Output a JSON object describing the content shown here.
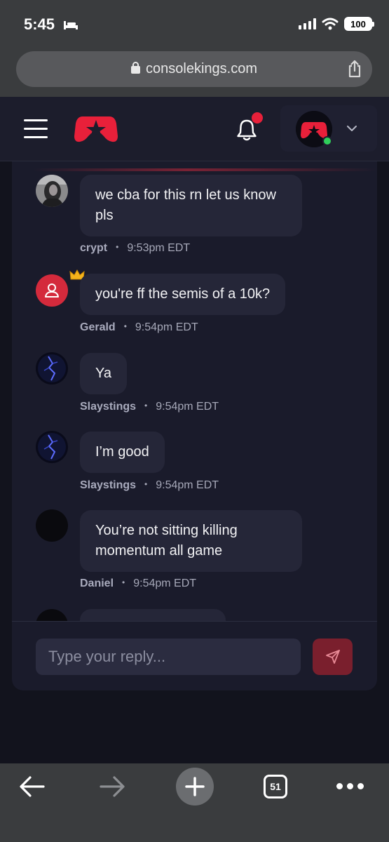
{
  "status_bar": {
    "time": "5:45",
    "battery": "100"
  },
  "browser": {
    "url": "consolekings.com",
    "tab_count": "51"
  },
  "header": {
    "notification_badge": true
  },
  "messages": [
    {
      "author": "crypt",
      "time": "9:53pm EDT",
      "text": "we cba for this rn let us know pls",
      "avatar": "photo"
    },
    {
      "author": "Gerald",
      "time": "9:54pm EDT",
      "text": "you're ff the semis of a 10k?",
      "avatar": "default-user-icon",
      "badge": "crown-icon"
    },
    {
      "author": "Slaystings",
      "time": "9:54pm EDT",
      "text": "Ya",
      "avatar": "lightning"
    },
    {
      "author": "Slaystings",
      "time": "9:54pm EDT",
      "text": "I’m good",
      "avatar": "lightning"
    },
    {
      "author": "Daniel",
      "time": "9:54pm EDT",
      "text": "You’re not sitting killing momentum all game",
      "avatar": "dark"
    }
  ],
  "reply": {
    "placeholder": "Type your reply..."
  },
  "colors": {
    "brand": "#e8203a",
    "online": "#2fcf5a",
    "panel": "#1a1b2b",
    "bubble": "#252638"
  }
}
